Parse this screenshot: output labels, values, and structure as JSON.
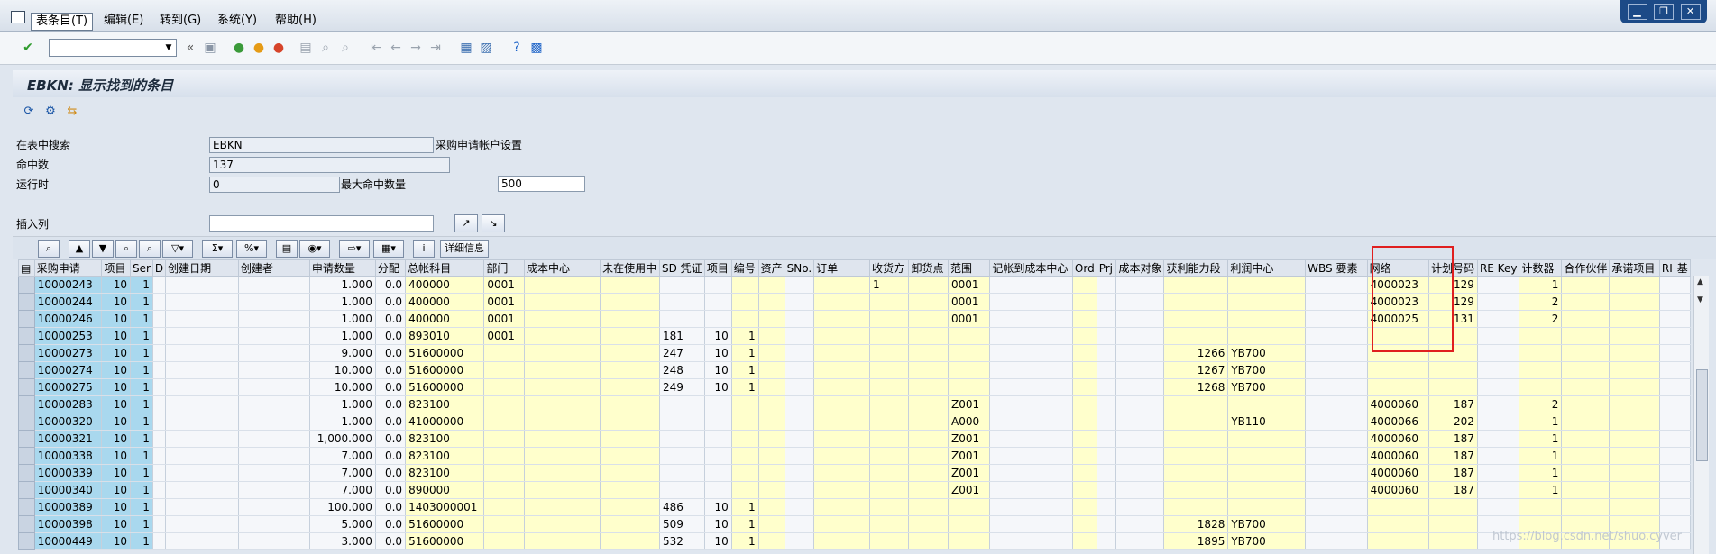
{
  "menubar": {
    "items": [
      "表条目(T)",
      "编辑(E)",
      "转到(G)",
      "系统(Y)",
      "帮助(H)"
    ]
  },
  "window_controls": [
    "▁",
    "❐",
    "✕"
  ],
  "toolbar": {
    "back": "«"
  },
  "title": "EBKN: 显示找到的条目",
  "form": {
    "search_label": "在表中搜索",
    "search_value": "EBKN",
    "search_desc": "采购申请帐户设置",
    "hits_label": "命中数",
    "hits_value": "137",
    "runtime_label": "运行时",
    "runtime_value": "0",
    "max_hits_label": "最大命中数量",
    "max_hits_value": "500",
    "insert_col_label": "插入列"
  },
  "grid_toolbar": {
    "detail_label": "详细信息"
  },
  "table": {
    "headers": [
      "采购申请",
      "项目",
      "Ser",
      "D",
      "创建日期",
      "创建者",
      "申请数量",
      "分配",
      "总帐科目",
      "部门",
      "成本中心",
      "未在使用中",
      "SD 凭证",
      "项目",
      "编号",
      "资产",
      "SNo.",
      "订单",
      "收货方",
      "卸货点",
      "范围",
      "记帐到成本中心",
      "Ord",
      "Prj",
      "成本对象",
      "获利能力段",
      "利润中心",
      "WBS 要素",
      "网络",
      "计划号码",
      "RE Key",
      "计数器",
      "合作伙伴",
      "承诺项目",
      "RI",
      "基"
    ],
    "rows": [
      [
        "10000243",
        "10",
        "1",
        "",
        "",
        "",
        "1.000",
        "0.0",
        "400000",
        "0001",
        "",
        "",
        "",
        "",
        "",
        "",
        "",
        "",
        "1",
        "",
        "0001",
        "",
        "",
        "",
        "",
        "",
        "",
        "",
        "4000023",
        "129",
        "",
        "1",
        "",
        "",
        "",
        ""
      ],
      [
        "10000244",
        "10",
        "1",
        "",
        "",
        "",
        "1.000",
        "0.0",
        "400000",
        "0001",
        "",
        "",
        "",
        "",
        "",
        "",
        "",
        "",
        "",
        "",
        "0001",
        "",
        "",
        "",
        "",
        "",
        "",
        "",
        "4000023",
        "129",
        "",
        "2",
        "",
        "",
        "",
        ""
      ],
      [
        "10000246",
        "10",
        "1",
        "",
        "",
        "",
        "1.000",
        "0.0",
        "400000",
        "0001",
        "",
        "",
        "",
        "",
        "",
        "",
        "",
        "",
        "",
        "",
        "0001",
        "",
        "",
        "",
        "",
        "",
        "",
        "",
        "4000025",
        "131",
        "",
        "2",
        "",
        "",
        "",
        ""
      ],
      [
        "10000253",
        "10",
        "1",
        "",
        "",
        "",
        "1.000",
        "0.0",
        "893010",
        "0001",
        "",
        "",
        "181",
        "10",
        "1",
        "",
        "",
        "",
        "",
        "",
        "",
        "",
        "",
        "",
        "",
        "",
        "",
        "",
        "",
        "",
        "",
        "",
        "",
        "",
        "",
        ""
      ],
      [
        "10000273",
        "10",
        "1",
        "",
        "",
        "",
        "9.000",
        "0.0",
        "51600000",
        "",
        "",
        "",
        "247",
        "10",
        "1",
        "",
        "",
        "",
        "",
        "",
        "",
        "",
        "",
        "",
        "",
        "1266",
        "YB700",
        "",
        "",
        "",
        "",
        "",
        "",
        "",
        "",
        ""
      ],
      [
        "10000274",
        "10",
        "1",
        "",
        "",
        "",
        "10.000",
        "0.0",
        "51600000",
        "",
        "",
        "",
        "248",
        "10",
        "1",
        "",
        "",
        "",
        "",
        "",
        "",
        "",
        "",
        "",
        "",
        "1267",
        "YB700",
        "",
        "",
        "",
        "",
        "",
        "",
        "",
        "",
        ""
      ],
      [
        "10000275",
        "10",
        "1",
        "",
        "",
        "",
        "10.000",
        "0.0",
        "51600000",
        "",
        "",
        "",
        "249",
        "10",
        "1",
        "",
        "",
        "",
        "",
        "",
        "",
        "",
        "",
        "",
        "",
        "1268",
        "YB700",
        "",
        "",
        "",
        "",
        "",
        "",
        "",
        "",
        ""
      ],
      [
        "10000283",
        "10",
        "1",
        "",
        "",
        "",
        "1.000",
        "0.0",
        "823100",
        "",
        "",
        "",
        "",
        "",
        "",
        "",
        "",
        "",
        "",
        "",
        "Z001",
        "",
        "",
        "",
        "",
        "",
        "",
        "",
        "4000060",
        "187",
        "",
        "2",
        "",
        "",
        "",
        ""
      ],
      [
        "10000320",
        "10",
        "1",
        "",
        "",
        "",
        "1.000",
        "0.0",
        "41000000",
        "",
        "",
        "",
        "",
        "",
        "",
        "",
        "",
        "",
        "",
        "",
        "A000",
        "",
        "",
        "",
        "",
        "",
        "YB110",
        "",
        "4000066",
        "202",
        "",
        "1",
        "",
        "",
        "",
        ""
      ],
      [
        "10000321",
        "10",
        "1",
        "",
        "",
        "",
        "1,000.000",
        "0.0",
        "823100",
        "",
        "",
        "",
        "",
        "",
        "",
        "",
        "",
        "",
        "",
        "",
        "Z001",
        "",
        "",
        "",
        "",
        "",
        "",
        "",
        "4000060",
        "187",
        "",
        "1",
        "",
        "",
        "",
        ""
      ],
      [
        "10000338",
        "10",
        "1",
        "",
        "",
        "",
        "7.000",
        "0.0",
        "823100",
        "",
        "",
        "",
        "",
        "",
        "",
        "",
        "",
        "",
        "",
        "",
        "Z001",
        "",
        "",
        "",
        "",
        "",
        "",
        "",
        "4000060",
        "187",
        "",
        "1",
        "",
        "",
        "",
        ""
      ],
      [
        "10000339",
        "10",
        "1",
        "",
        "",
        "",
        "7.000",
        "0.0",
        "823100",
        "",
        "",
        "",
        "",
        "",
        "",
        "",
        "",
        "",
        "",
        "",
        "Z001",
        "",
        "",
        "",
        "",
        "",
        "",
        "",
        "4000060",
        "187",
        "",
        "1",
        "",
        "",
        "",
        ""
      ],
      [
        "10000340",
        "10",
        "1",
        "",
        "",
        "",
        "7.000",
        "0.0",
        "890000",
        "",
        "",
        "",
        "",
        "",
        "",
        "",
        "",
        "",
        "",
        "",
        "Z001",
        "",
        "",
        "",
        "",
        "",
        "",
        "",
        "4000060",
        "187",
        "",
        "1",
        "",
        "",
        "",
        ""
      ],
      [
        "10000389",
        "10",
        "1",
        "",
        "",
        "",
        "100.000",
        "0.0",
        "1403000001",
        "",
        "",
        "",
        "486",
        "10",
        "1",
        "",
        "",
        "",
        "",
        "",
        "",
        "",
        "",
        "",
        "",
        "",
        "",
        "",
        "",
        "",
        "",
        "",
        "",
        "",
        "",
        ""
      ],
      [
        "10000398",
        "10",
        "1",
        "",
        "",
        "",
        "5.000",
        "0.0",
        "51600000",
        "",
        "",
        "",
        "509",
        "10",
        "1",
        "",
        "",
        "",
        "",
        "",
        "",
        "",
        "",
        "",
        "",
        "1828",
        "YB700",
        "",
        "",
        "",
        "",
        "",
        "",
        "",
        "",
        ""
      ],
      [
        "10000449",
        "10",
        "1",
        "",
        "",
        "",
        "3.000",
        "0.0",
        "51600000",
        "",
        "",
        "",
        "532",
        "10",
        "1",
        "",
        "",
        "",
        "",
        "",
        "",
        "",
        "",
        "",
        "",
        "1895",
        "YB700",
        "",
        "",
        "",
        "",
        "",
        "",
        "",
        "",
        ""
      ]
    ]
  },
  "watermark": "https://blog.csdn.net/shuo.cyver"
}
